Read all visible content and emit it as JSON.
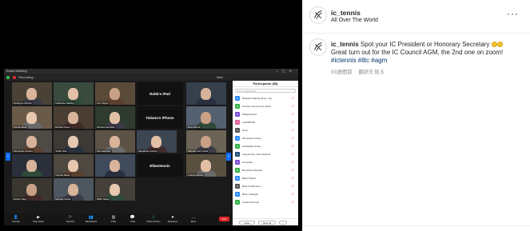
{
  "zoom": {
    "window_title": "Zoom Meeting",
    "recording_label": "Recording...",
    "view_label": "View",
    "tiles": [
      {
        "name": "Rodrigo's iPhone"
      },
      {
        "name": "Catherine Starling"
      },
      {
        "name": "Tom Taylor"
      },
      {
        "name": ""
      },
      {
        "name": "Nicola Alison"
      },
      {
        "name": "Richard Faure"
      },
      {
        "name": "Richard Hamilton"
      },
      {
        "name": "Ross Brown"
      },
      {
        "name": "Alexander Kehres"
      },
      {
        "name": "Judith Hick"
      },
      {
        "name": "Gib Helicherr"
      },
      {
        "name": "Alexander Kehres"
      },
      {
        "name": "Michael John Scott"
      },
      {
        "name": ""
      },
      {
        "name": "Virginia Wade"
      },
      {
        "name": ""
      },
      {
        "name": "Andrew Burton"
      },
      {
        "name": "Robert Hiley"
      },
      {
        "name": "Michael Carter"
      },
      {
        "name": "Mitch Swart"
      }
    ],
    "name_boxes": [
      "Robb's iPad",
      "Tatiana's iPhone",
      "Ellamtennis"
    ],
    "toolbar": [
      {
        "icon": "👤",
        "label": "Unmute"
      },
      {
        "icon": "▶",
        "label": "Stop Video"
      },
      {
        "icon": "⚐",
        "label": "Security"
      },
      {
        "icon": "👥",
        "label": "Participants"
      },
      {
        "icon": "▥",
        "label": "Polls"
      },
      {
        "icon": "💬",
        "label": "Chat"
      },
      {
        "icon": "⇧",
        "label": "Share Screen"
      },
      {
        "icon": "⏺",
        "label": "Reactions"
      },
      {
        "icon": "…",
        "label": "More"
      }
    ],
    "end_label": "End",
    "participants": {
      "title": "Participants (88)",
      "search_placeholder": "Find a participant",
      "rows": [
        {
          "initial": "N",
          "name": "Natasha Starling (Host, me)",
          "color": "#2d8cff"
        },
        {
          "initial": "G",
          "name": "Gustavo Herrera (Co-Host)",
          "color": "#35b24a"
        },
        {
          "initial": "P",
          "name": "Philippa Ross",
          "color": "#7a4fd6"
        },
        {
          "initial": "1",
          "name": "1123456789",
          "color": "#e0669c"
        },
        {
          "initial": "A",
          "name": "aixon",
          "color": "#555555"
        },
        {
          "initial": "A",
          "name": "Alexander Kehres",
          "color": "#2d8cff"
        },
        {
          "initial": "A",
          "name": "andhardkmunsan",
          "color": "#35b24a"
        },
        {
          "initial": "A",
          "name": "Angela Hart, New Zealand",
          "color": "#1f4e79"
        },
        {
          "initial": "A",
          "name": "annaclark",
          "color": "#7a4fd6"
        },
        {
          "initial": "B",
          "name": "Bel (Hana Mandel)",
          "color": "#35b24a"
        },
        {
          "initial": "B",
          "name": "Bella Tinkers",
          "color": "#2d8cff"
        },
        {
          "initial": "B",
          "name": "Brad Cuthbertson",
          "color": "#555555"
        },
        {
          "initial": "B",
          "name": "Brian Collingan",
          "color": "#2d8cff"
        },
        {
          "initial": "C",
          "name": "Carlos Montoya",
          "color": "#35b24a"
        }
      ],
      "invite_label": "Invite",
      "mute_all_label": "Mute All",
      "more_label": "..."
    }
  },
  "post": {
    "username": "ic_tennis",
    "location": "All Over The World",
    "more_icon": "more-horizontal-icon",
    "caption_user": "ic_tennis",
    "caption_text": "Spot your IC President or Honorary Secretary",
    "caption_line2": "Great turn out for the IC Council AGM, the 2nd one on zoom!",
    "hashtags": "#ictennis #iltc #agm",
    "time_ago": "93週間前",
    "translate": "翻訳を見る"
  }
}
